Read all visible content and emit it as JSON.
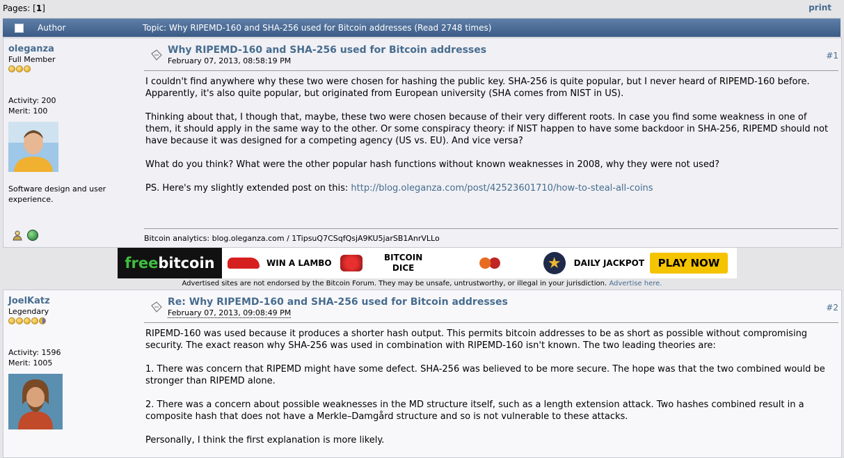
{
  "pages": {
    "label": "Pages: [",
    "current": "1",
    "close": "]"
  },
  "print_label": "print",
  "header": {
    "author": "Author",
    "topic": "Topic: Why RIPEMD-160 and SHA-256 used for Bitcoin addresses  (Read 2748 times)"
  },
  "posts": [
    {
      "poster": "oleganza",
      "rank": "Full Member",
      "stars": 3,
      "activity": "Activity: 200",
      "merit": "Merit: 100",
      "bio": "Software design and user experience.",
      "subject": "Why RIPEMD-160 and SHA-256 used for Bitcoin addresses",
      "date": "February 07, 2013, 08:58:19 PM",
      "number": "#1",
      "paragraphs": [
        "I couldn't find anywhere why these two were chosen for hashing the public key. SHA-256 is quite popular, but I never heard of RIPEMD-160 before. Apparently, it's also quite popular, but originated from European university (SHA comes from NIST in US).",
        "Thinking about that, I though that, maybe, these two were chosen because of their very different roots. In case you find some weakness in one of them, it should apply in the same way to the other. Or some conspiracy theory: if NIST happen to have some backdoor in  SHA-256, RIPEMD should not have because it was designed for a competing agency (US vs. EU). And vice versa?",
        "What do you think? What were the other popular hash functions without known weaknesses in 2008, why they were not used?"
      ],
      "ps_prefix": "PS. Here's my slightly extended post on this: ",
      "ps_link": "http://blog.oleganza.com/post/42523601710/how-to-steal-all-coins",
      "signature": "Bitcoin analytics: blog.oleganza.com / 1TipsuQ7CSqfQsjA9KU5jarSB1AnrVLLo"
    },
    {
      "poster": "JoelKatz",
      "rank": "Legendary",
      "stars": 5,
      "activity": "Activity: 1596",
      "merit": "Merit: 1005",
      "subject": "Re: Why RIPEMD-160 and SHA-256 used for Bitcoin addresses",
      "date": "February 07, 2013, 09:08:49 PM",
      "number": "#2",
      "paragraphs": [
        "RIPEMD-160 was used because it produces a shorter hash output. This permits bitcoin addresses to be as short as possible without compromising security. The exact reason why SHA-256 was used in combination with RIPEMD-160 isn't known. The two leading theories are:",
        "1. There was concern that RIPEMD might have some defect. SHA-256 was believed to be more secure. The hope was that the two combined would be stronger than RIPEMD alone.",
        "2. There was a concern about possible weaknesses in the MD structure itself, such as a length extension attack. Two hashes combined result in a composite hash that does not have a Merkle–Damgård structure and so is not vulnerable to these attacks.",
        "Personally, I think the first explanation is more likely."
      ]
    }
  ],
  "ad": {
    "logo_free": "free",
    "logo_bitcoin": "bitcoin",
    "lambo": "WIN A LAMBO",
    "dice": "BITCOIN DICE",
    "jackpot": "DAILY JACKPOT",
    "play": "PLAY NOW",
    "disclaimer": "Advertised sites are not endorsed by the Bitcoin Forum. They may be unsafe, untrustworthy, or illegal in your jurisdiction. ",
    "advertise": "Advertise here."
  },
  "colors": {
    "link": "#476c8e",
    "header_bar": "#3b5b85"
  }
}
